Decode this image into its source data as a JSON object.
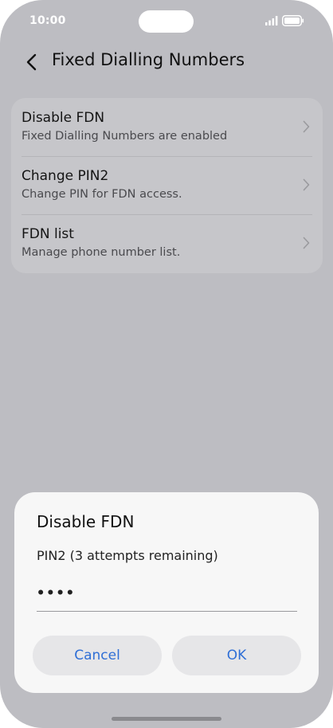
{
  "status_bar": {
    "time": "10:00"
  },
  "header": {
    "title": "Fixed Dialling Numbers",
    "back_icon": "back-arrow-icon"
  },
  "settings": {
    "items": [
      {
        "title": "Disable FDN",
        "subtitle": "Fixed Dialling Numbers are enabled"
      },
      {
        "title": "Change PIN2",
        "subtitle": "Change PIN for FDN access."
      },
      {
        "title": "FDN list",
        "subtitle": "Manage phone number list."
      }
    ]
  },
  "dialog": {
    "title": "Disable FDN",
    "label": "PIN2 (3 attempts remaining)",
    "pin_value": "••••",
    "cancel_label": "Cancel",
    "ok_label": "OK"
  },
  "colors": {
    "screen_bg": "#bdbdc2",
    "card_bg": "#c6c6ca",
    "dialog_bg": "#f7f7f7",
    "button_bg": "#e6e6e8",
    "accent": "#2f6fd6"
  }
}
